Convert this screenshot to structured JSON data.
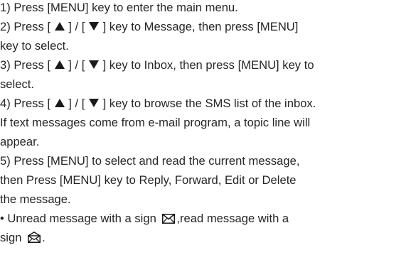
{
  "step1": {
    "text": "1) Press [MENU] key to enter the main menu."
  },
  "step2": {
    "prefix": "2) Press [",
    "mid": "] / [",
    "suffix": "] key to Message, then press [MENU]",
    "cont": "key to select."
  },
  "step3": {
    "prefix": "3) Press [",
    "mid": "] / [",
    "suffix": "] key to Inbox, then press [MENU] key to",
    "cont": "select."
  },
  "step4": {
    "prefix": "4) Press [",
    "mid": "] / [",
    "suffix": "] key to browse the SMS list of the inbox.",
    "cont1": "If text messages come from e-mail program, a topic line will",
    "cont2": "appear."
  },
  "step5": {
    "line1": "5) Press [MENU] to select and read the current message,",
    "line2": "then Press [MENU] key to Reply, Forward, Edit or Delete",
    "line3": "the message."
  },
  "note": {
    "prefix": "• Unread message with a sign",
    "middle": ",read message with a",
    "line2_prefix": "sign",
    "line2_suffix": "."
  },
  "icons": {
    "up": "up-triangle-icon",
    "down": "down-triangle-icon",
    "unread": "unread-envelope-icon",
    "read": "read-envelope-icon"
  }
}
